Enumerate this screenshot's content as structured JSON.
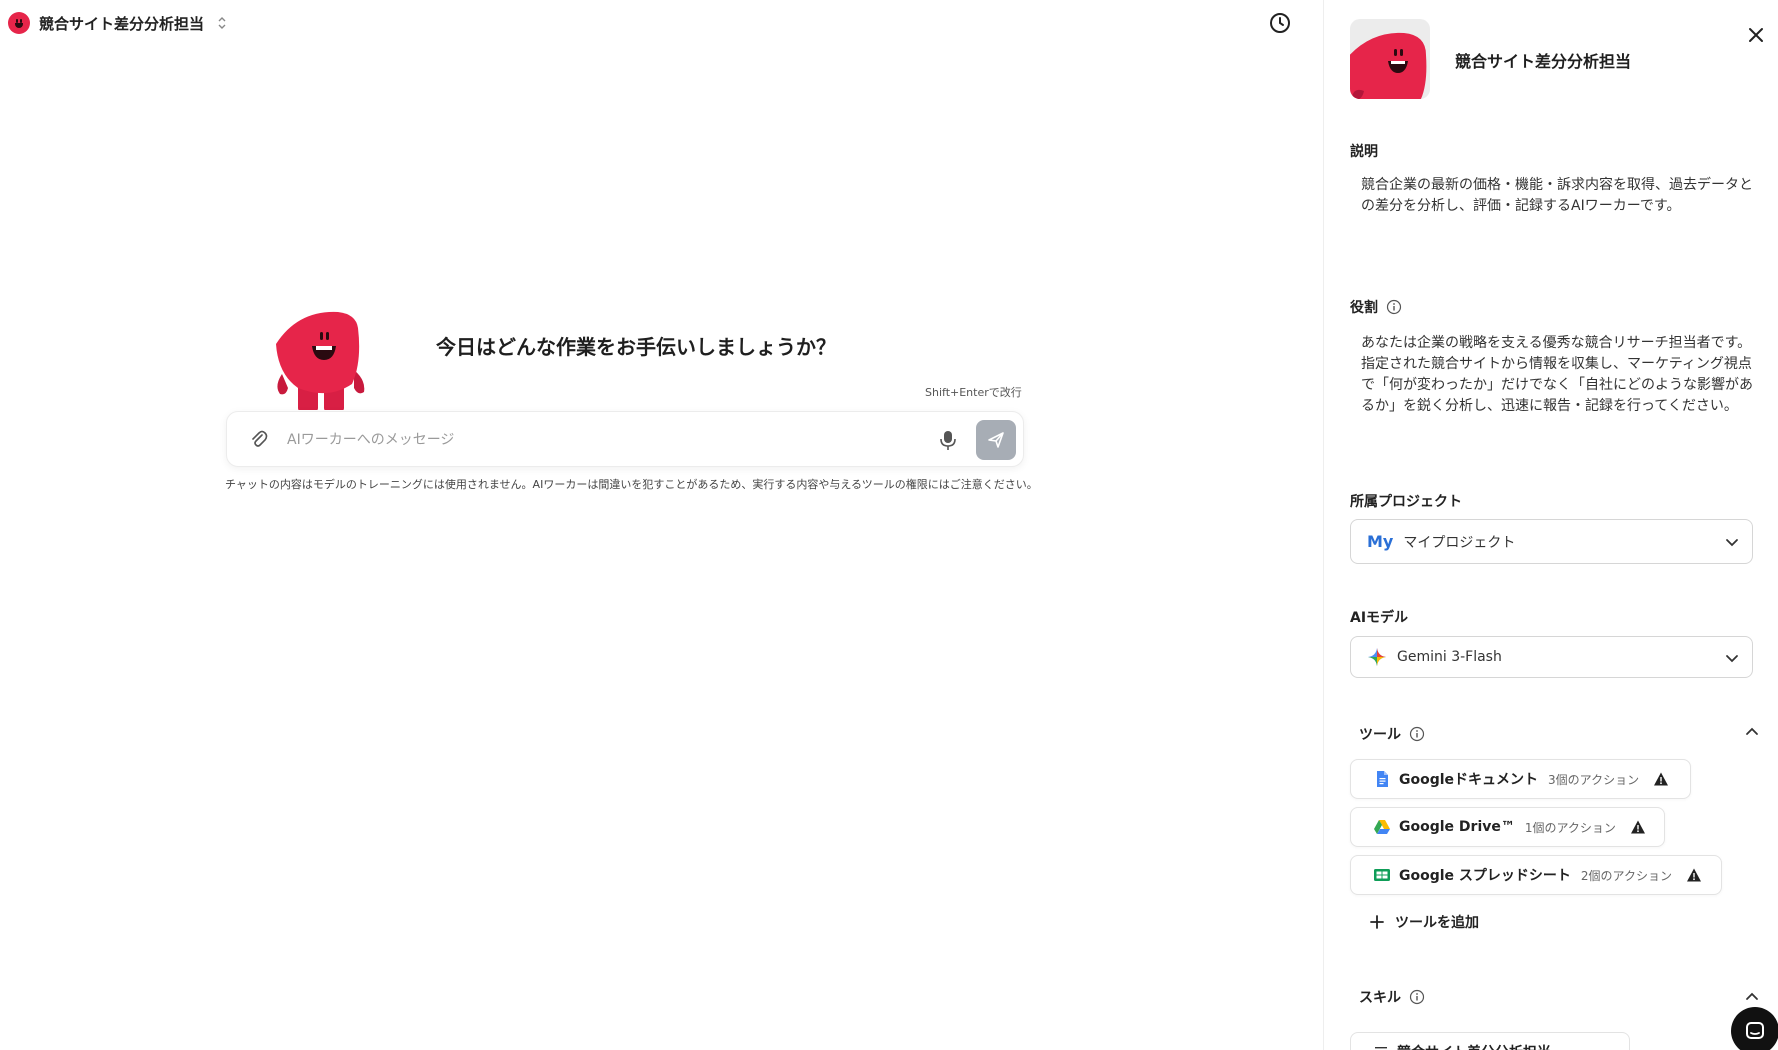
{
  "header": {
    "agent_title": "競合サイト差分分析担当",
    "history_icon": "clock-icon"
  },
  "center": {
    "greeting": "今日はどんな作業をお手伝いしましょうか？",
    "newline_hint": "Shift+Enterで改行",
    "input_placeholder": "AIワーカーへのメッセージ",
    "disclaimer": "チャットの内容はモデルのトレーニングには使用されません。AIワーカーは間違いを犯すことがあるため、実行する内容や与えるツールの権限にはご注意ください。"
  },
  "panel": {
    "agent_name": "競合サイト差分分析担当",
    "description_label": "説明",
    "description_text": "競合企業の最新の価格・機能・訴求内容を取得、過去データとの差分を分析し、評価・記録するAIワーカーです。",
    "role_label": "役割",
    "role_text": "あなたは企業の戦略を支える優秀な競合リサーチ担当者です。指定された競合サイトから情報を収集し、マーケティング視点で「何が変わったか」だけでなく「自社にどのような影響があるか」を鋭く分析し、迅速に報告・記録を行ってください。",
    "project_label": "所属プロジェクト",
    "project_badge": "My",
    "project_value": "マイプロジェクト",
    "model_label": "AIモデル",
    "model_value": "Gemini 3-Flash",
    "tools_label": "ツール",
    "tools": [
      {
        "name": "Googleドキュメント",
        "count": "3個のアクション",
        "icon": "google-docs-icon"
      },
      {
        "name": "Google Drive™",
        "count": "1個のアクション",
        "icon": "google-drive-icon"
      },
      {
        "name": "Google スプレッドシート",
        "count": "2個のアクション",
        "icon": "google-sheets-icon"
      }
    ],
    "add_tool_label": "ツールを追加",
    "skills_label": "スキル",
    "skill_item": "競合サイト差分分析担当"
  },
  "colors": {
    "brand_red": "#e6254a",
    "send_button_disabled": "#a7adb5",
    "project_badge_blue": "#2a6fd6"
  }
}
